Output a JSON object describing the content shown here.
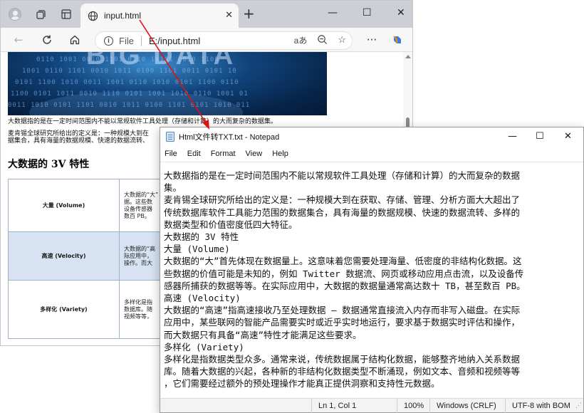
{
  "browser": {
    "tab_title": "input.html",
    "address": {
      "scheme_label": "File",
      "url": "E:/input.html"
    },
    "page": {
      "hero_title": "BIG DATA",
      "intro_line": "大数据指的是在一定时间范围内不能以常规软件工具处理（存储和计算）的大而复杂的数据集。",
      "definition_line_1": "麦肯锡全球研究所给出的定义是：一种规模大到在",
      "definition_line_2": "据集合，具有海量的数据规模、快速的数据流转、",
      "section_heading": "大数据的 3V 特性",
      "rows": [
        {
          "name": "大量 (Volume)",
          "desc": [
            "大数据的“大”",
            "据。这些数",
            "设备传感器",
            "数百 PB。"
          ]
        },
        {
          "name": "高速 (Velocity)",
          "desc": [
            "大数据的“高",
            "际应用中，",
            "操作。而大"
          ]
        },
        {
          "name": "多样化 (Variety)",
          "desc": [
            "多样化是指",
            "数据库。随",
            "视频等等，"
          ]
        }
      ]
    }
  },
  "notepad": {
    "title": "Html文件转TXT.txt - Notepad",
    "menu": [
      "File",
      "Edit",
      "Format",
      "View",
      "Help"
    ],
    "lines": [
      "大数据指的是在一定时间范围内不能以常规软件工具处理（存储和计算）的大而复杂的数据",
      "集。",
      "麦肯锡全球研究所给出的定义是：一种规模大到在获取、存储、管理、分析方面大大超出了",
      "传统数据库软件工具能力范围的数据集合，具有海量的数据规模、快速的数据流转、多样的",
      "数据类型和价值密度低四大特征。",
      "大数据的 3V 特性",
      "大量 (Volume)",
      "大数据的“大”首先体现在数据量上。这意味着您需要处理海量、低密度的非结构化数据。这",
      "些数据的价值可能是未知的，例如 Twitter 数据流、网页或移动应用点击流，以及设备传",
      "感器所捕获的数据等等。在实际应用中，大数据的数据量通常高达数十 TB，甚至数百 PB。",
      "高速 (Velocity)",
      "大数据的“高速”指高速接收乃至处理数据 — 数据通常直接流入内存而非写入磁盘。在实际",
      "应用中，某些联网的智能产品需要实时或近乎实时地运行，要求基于数据实时评估和操作，",
      "而大数据只有具备“高速”特性才能满足这些要求。",
      "多样化 (Variety)",
      "多样化是指数据类型众多。通常来说，传统数据属于结构化数据，能够整齐地纳入关系数据",
      "库。随着大数据的兴起，各种新的非结构化数据类型不断涌现，例如文本、音频和视频等等",
      "，它们需要经过额外的预处理操作才能真正提供洞察和支持性元数据。"
    ],
    "status": {
      "position": "Ln 1, Col 1",
      "zoom": "100%",
      "line_ending": "Windows (CRLF)",
      "encoding": "UTF-8 with BOM"
    }
  },
  "colors": {
    "annotation_arrow": "#e01010",
    "table_highlight": "#d7e3f3"
  }
}
